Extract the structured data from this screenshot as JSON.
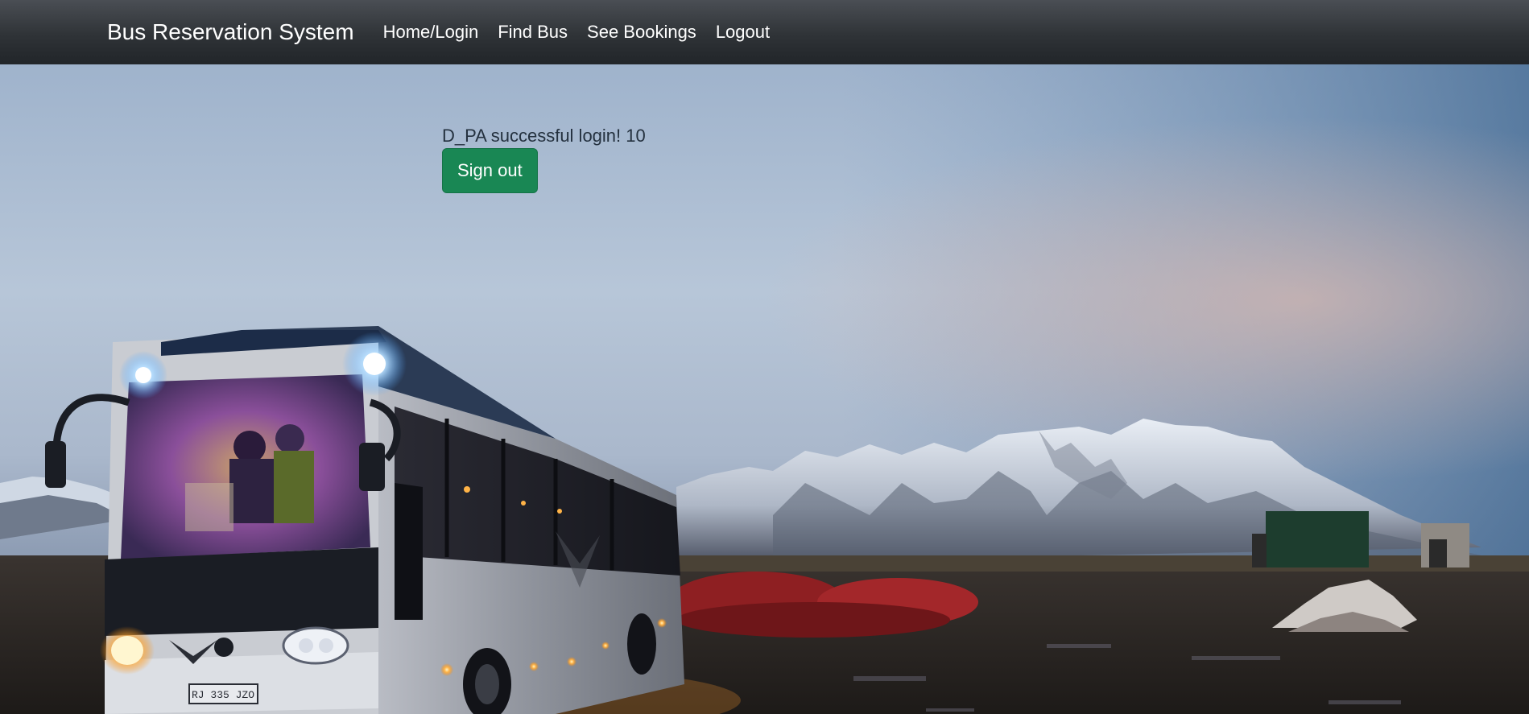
{
  "navbar": {
    "brand": "Bus Reservation System",
    "links": [
      {
        "label": "Home/Login"
      },
      {
        "label": "Find Bus"
      },
      {
        "label": "See Bookings"
      },
      {
        "label": "Logout"
      }
    ]
  },
  "login": {
    "message": "D_PA successful login! 10",
    "signout_label": "Sign out"
  },
  "hero": {
    "plate_text": "RJ 335 JZO"
  },
  "colors": {
    "navbar_bg": "#212529",
    "signout_button": "#198754",
    "text_dark": "#24313f"
  }
}
